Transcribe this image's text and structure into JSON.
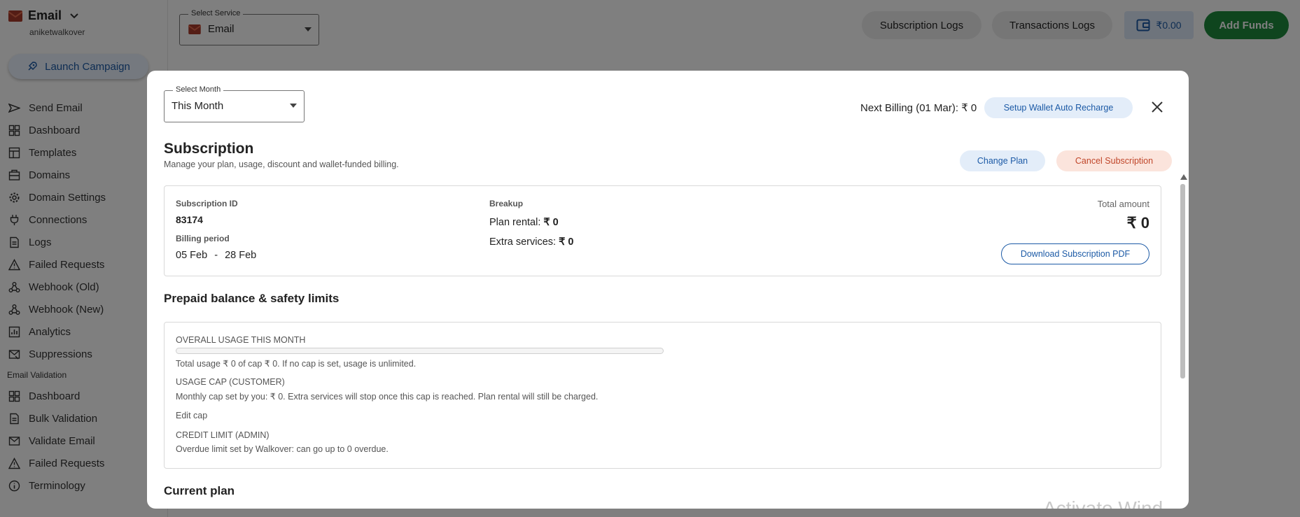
{
  "sidebar": {
    "brand_title": "Email",
    "username": "aniketwalkover",
    "launch_label": "Launch Campaign",
    "email_items": [
      {
        "label": "Send Email",
        "icon": "send-icon"
      },
      {
        "label": "Dashboard",
        "icon": "dashboard-icon"
      },
      {
        "label": "Templates",
        "icon": "templates-icon"
      },
      {
        "label": "Domains",
        "icon": "domains-icon"
      },
      {
        "label": "Domain Settings",
        "icon": "gear-icon"
      },
      {
        "label": "Connections",
        "icon": "plug-icon"
      },
      {
        "label": "Logs",
        "icon": "logs-icon"
      },
      {
        "label": "Failed Requests",
        "icon": "warning-icon"
      },
      {
        "label": "Webhook (Old)",
        "icon": "webhook-icon"
      },
      {
        "label": "Webhook (New)",
        "icon": "webhook-icon"
      },
      {
        "label": "Analytics",
        "icon": "analytics-icon"
      },
      {
        "label": "Suppressions",
        "icon": "suppressions-icon"
      }
    ],
    "validation_section": "Email Validation",
    "validation_items": [
      {
        "label": "Dashboard",
        "icon": "dashboard-icon"
      },
      {
        "label": "Bulk Validation",
        "icon": "bulk-icon"
      },
      {
        "label": "Validate Email",
        "icon": "mail-icon"
      },
      {
        "label": "Failed Requests",
        "icon": "warning-icon"
      },
      {
        "label": "Terminology",
        "icon": "info-icon"
      }
    ]
  },
  "topbar": {
    "service_legend": "Select Service",
    "service_value": "Email",
    "subscription_logs": "Subscription Logs",
    "transactions_logs": "Transactions Logs",
    "wallet_balance": "₹0.00",
    "add_funds": "Add Funds"
  },
  "modal": {
    "month_legend": "Select Month",
    "month_value": "This Month",
    "next_billing": "Next Billing (01 Mar): ₹ 0",
    "auto_recharge": "Setup Wallet Auto Recharge",
    "title": "Subscription",
    "description": "Manage your plan, usage, discount and wallet-funded billing.",
    "change_plan": "Change Plan",
    "cancel_subscription": "Cancel Subscription",
    "summary": {
      "subscription_id_label": "Subscription ID",
      "subscription_id": "83174",
      "billing_period_label": "Billing period",
      "billing_start": "05 Feb",
      "billing_sep": "-",
      "billing_end": "28 Feb",
      "breakup_label": "Breakup",
      "plan_rental_label": "Plan rental:",
      "plan_rental_value": "₹ 0",
      "extra_services_label": "Extra services:",
      "extra_services_value": "₹ 0",
      "total_label": "Total amount",
      "total_value": "₹ 0",
      "download_pdf": "Download Subscription PDF"
    },
    "prepaid_heading": "Prepaid balance & safety limits",
    "prepaid": {
      "usage_heading": "OVERALL USAGE THIS MONTH",
      "usage_progress": 0,
      "usage_text": "Total usage ₹ 0 of cap ₹ 0. If no cap is set, usage is unlimited.",
      "cap_heading": "USAGE CAP (CUSTOMER)",
      "cap_text": "Monthly cap set by you: ₹ 0. Extra services will stop once this cap is reached. Plan rental will still be charged.",
      "edit_cap": "Edit cap",
      "credit_heading": "CREDIT LIMIT (ADMIN)",
      "credit_text": "Overdue limit set by Walkover: can go up to 0 overdue."
    },
    "current_plan_heading": "Current plan"
  },
  "watermark": "Activate Wind",
  "colors": {
    "accent": "#1c5aa6",
    "success": "#1f8a3d",
    "danger": "#c0462a"
  }
}
